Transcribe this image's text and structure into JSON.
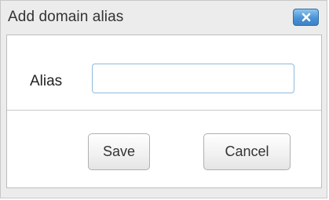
{
  "dialog": {
    "title": "Add domain alias",
    "close_icon": "close-icon",
    "accent_color": "#4a93d6"
  },
  "form": {
    "alias_label": "Alias",
    "alias_value": "",
    "alias_placeholder": ""
  },
  "buttons": {
    "save_label": "Save",
    "cancel_label": "Cancel"
  }
}
